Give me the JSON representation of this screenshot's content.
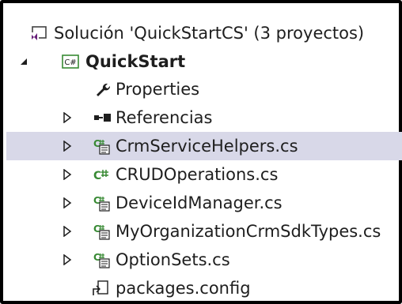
{
  "solution": {
    "label": "Solución 'QuickStartCS'  (3 proyectos)",
    "icon": "solution-icon"
  },
  "project": {
    "label": "QuickStart",
    "icon": "csharp-project-icon",
    "expanded": true
  },
  "items": [
    {
      "label": "Properties",
      "icon": "wrench-icon",
      "expandable": false
    },
    {
      "label": "Referencias",
      "icon": "references-icon",
      "expandable": true
    },
    {
      "label": "CrmServiceHelpers.cs",
      "icon": "csharp-generated-file-icon",
      "expandable": true,
      "selected": true
    },
    {
      "label": "CRUDOperations.cs",
      "icon": "csharp-file-icon",
      "expandable": true
    },
    {
      "label": "DeviceIdManager.cs",
      "icon": "csharp-generated-file-icon",
      "expandable": true
    },
    {
      "label": "MyOrganizationCrmSdkTypes.cs",
      "icon": "csharp-generated-file-icon",
      "expandable": true
    },
    {
      "label": "OptionSets.cs",
      "icon": "csharp-generated-file-icon",
      "expandable": true
    },
    {
      "label": "packages.config",
      "icon": "config-file-icon",
      "expandable": false
    }
  ],
  "colors": {
    "selection": "#d8d8e8",
    "csharp_green": "#388a34",
    "text": "#1e1e1e"
  }
}
